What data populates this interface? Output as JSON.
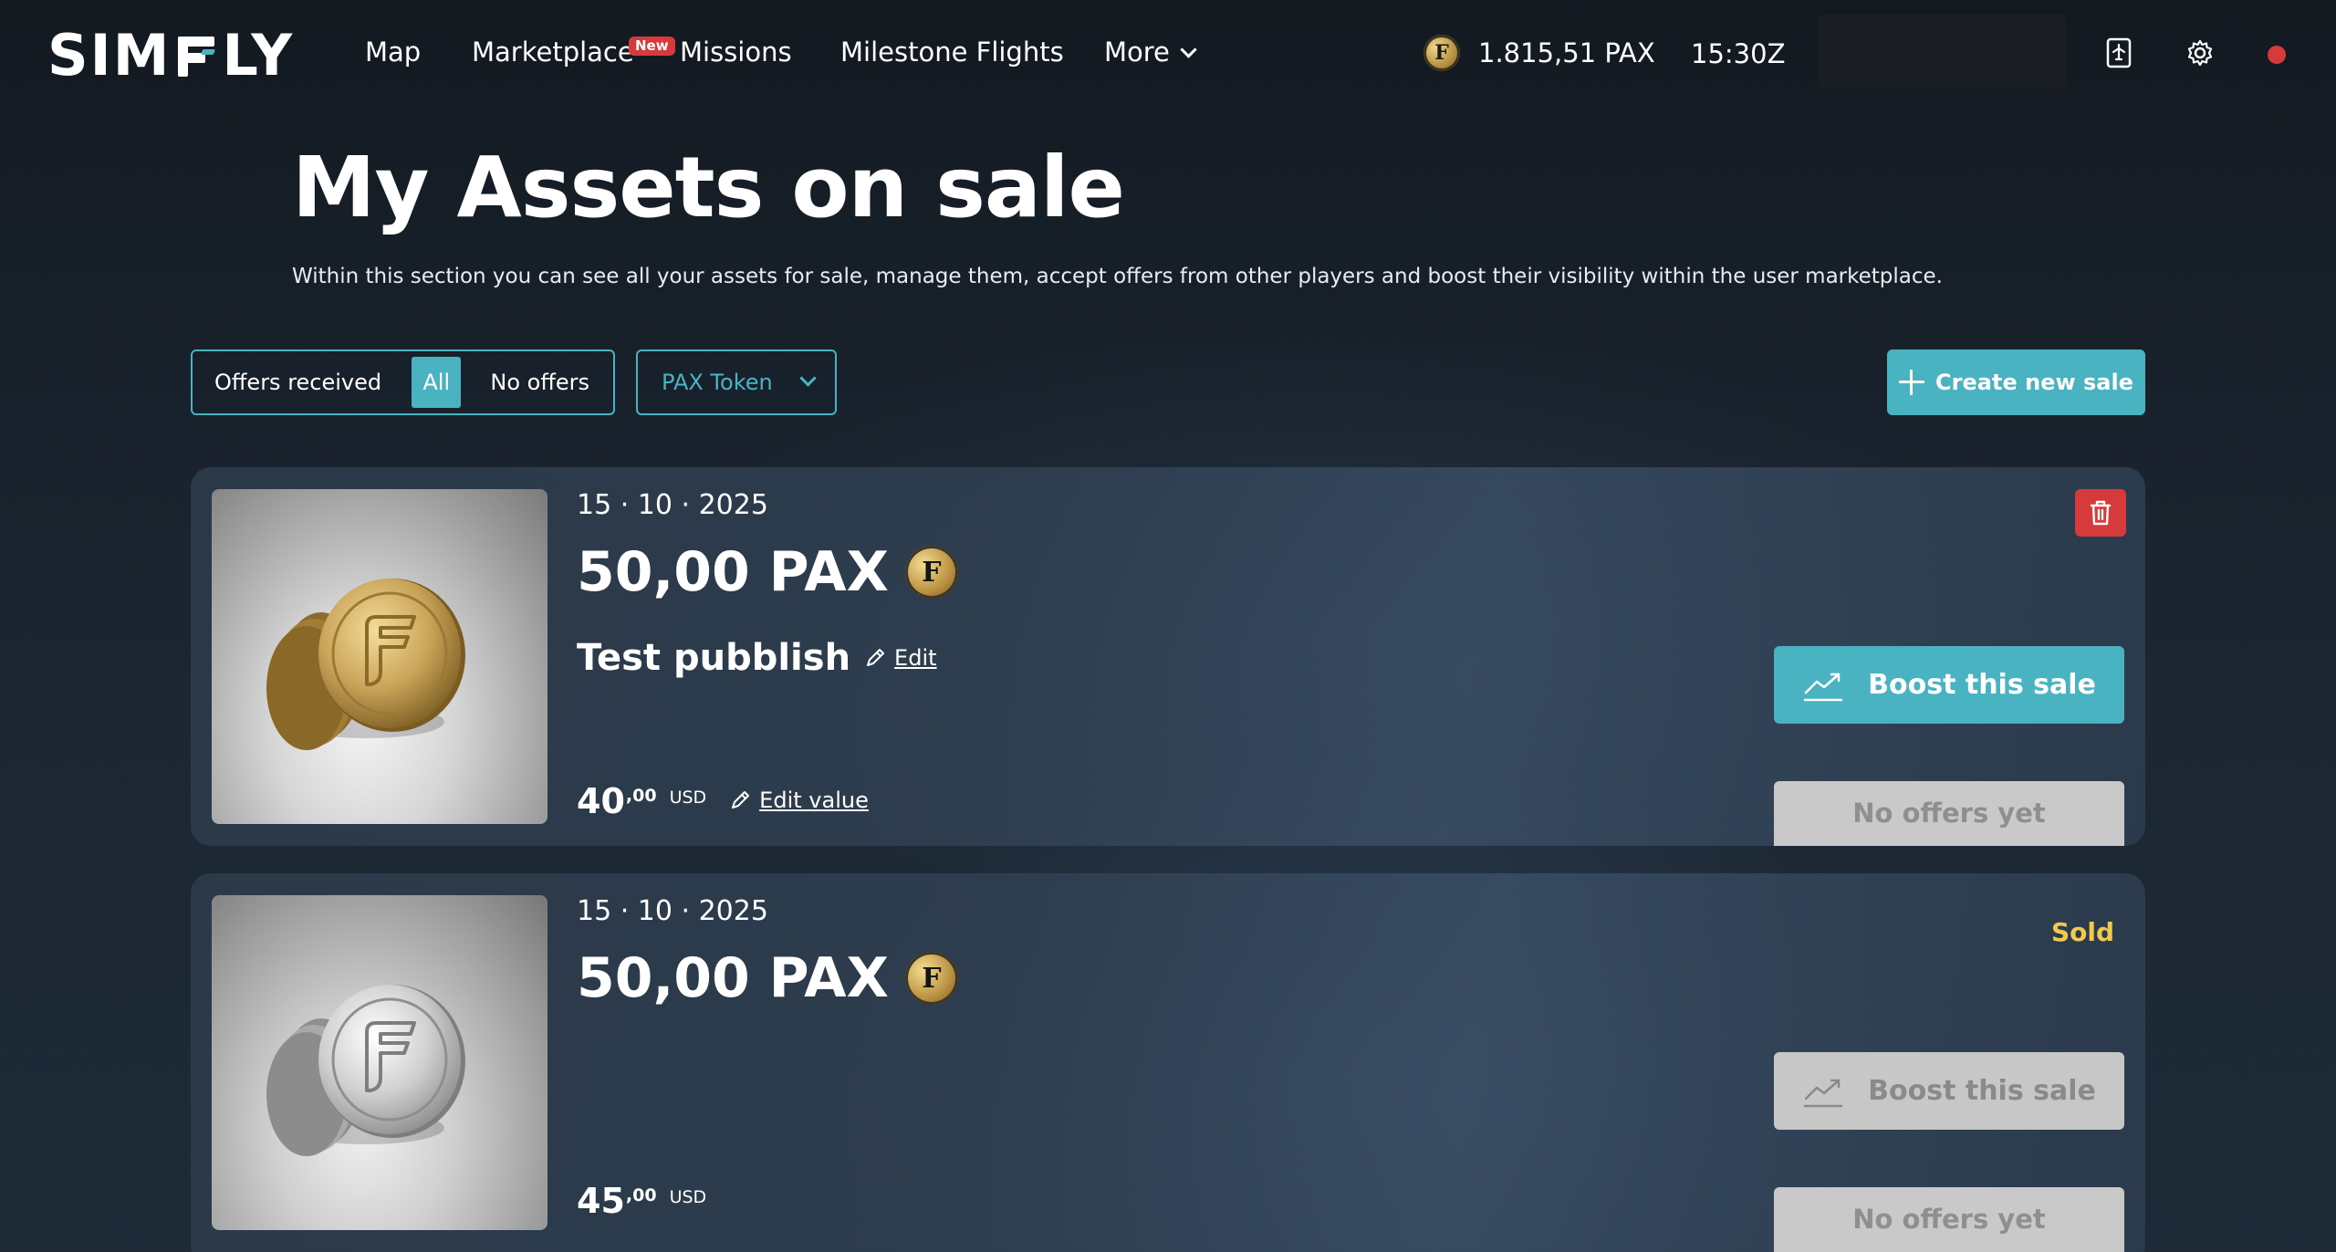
{
  "nav": {
    "logo_text_left": "SIM",
    "logo_text_right": "LY",
    "items": [
      "Map",
      "Marketplace",
      "Missions",
      "Milestone Flights",
      "More"
    ],
    "new_badge": "New",
    "pax_balance": "1.815,51 PAX",
    "clock": "15:30Z",
    "coin_glyph": "F"
  },
  "header": {
    "title": "My Assets on sale",
    "description": "Within this section you can see all your assets for sale, manage them, accept offers from other players and boost their visibility within the user marketplace."
  },
  "filters": {
    "offers_received_label": "Offers received",
    "all_label": "All",
    "no_offers_label": "No offers",
    "token_select_value": "PAX Token",
    "create_button": "Create new sale"
  },
  "sales": [
    {
      "date": "15 · 10 · 2025",
      "amount": "50,00 PAX",
      "name": "Test pubblish",
      "edit_label": "Edit",
      "price_int": "40",
      "price_dec": ",00",
      "currency": "USD",
      "edit_value_label": "Edit value",
      "boost_label": "Boost this sale",
      "offers_label": "No offers yet",
      "status": "",
      "coin_variant": "gold"
    },
    {
      "date": "15 · 10 · 2025",
      "amount": "50,00 PAX",
      "price_int": "45",
      "price_dec": ",00",
      "currency": "USD",
      "boost_label": "Boost this sale",
      "offers_label": "No offers yet",
      "status": "Sold",
      "coin_variant": "silver"
    }
  ],
  "colors": {
    "accent": "#49b3c2",
    "danger": "#d63a3a",
    "sold": "#f2c94c",
    "disabled": "#c7c7c7"
  }
}
